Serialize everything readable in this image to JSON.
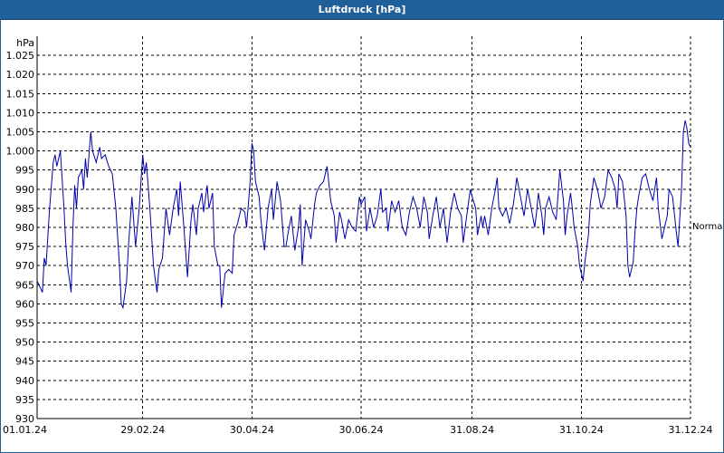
{
  "window": {
    "title": "Luftdruck [hPa]"
  },
  "colors": {
    "titlebar": "#1f5f9a",
    "line": "#0000aa",
    "grid": "#000000"
  },
  "chart_data": {
    "type": "line",
    "title": "Luftdruck [hPa]",
    "ylabel": "hPa",
    "ylim": [
      930,
      1030
    ],
    "yticks": [
      "930",
      "935",
      "940",
      "945",
      "950",
      "955",
      "960",
      "965",
      "970",
      "975",
      "980",
      "985",
      "990",
      "995",
      "1.000",
      "1.005",
      "1.010",
      "1.015",
      "1.020",
      "1.025"
    ],
    "ytick_values": [
      930,
      935,
      940,
      945,
      950,
      955,
      960,
      965,
      970,
      975,
      980,
      985,
      990,
      995,
      1000,
      1005,
      1010,
      1015,
      1020,
      1025
    ],
    "xlim": [
      "01.01.24",
      "31.12.24"
    ],
    "xticks": [
      "01.01.24",
      "29.02.24",
      "30.04.24",
      "30.06.24",
      "31.08.24",
      "31.10.24",
      "31.12.24"
    ],
    "xtick_days": [
      0,
      59,
      120,
      181,
      243,
      304,
      365
    ],
    "grid": true,
    "annotation": {
      "text": "Normal",
      "y": 980.5
    },
    "series_key": [
      [
        0,
        966
      ],
      [
        3,
        963
      ],
      [
        4,
        972
      ],
      [
        5,
        970
      ],
      [
        7,
        985
      ],
      [
        9,
        997
      ],
      [
        10,
        999
      ],
      [
        11,
        996
      ],
      [
        13,
        1000
      ],
      [
        15,
        985
      ],
      [
        16,
        976
      ],
      [
        17,
        970
      ],
      [
        19,
        963
      ],
      [
        20,
        980
      ],
      [
        21,
        991
      ],
      [
        22,
        985
      ],
      [
        23,
        993
      ],
      [
        25,
        995
      ],
      [
        26,
        990
      ],
      [
        27,
        998
      ],
      [
        28,
        993
      ],
      [
        30,
        1005
      ],
      [
        31,
        1000
      ],
      [
        33,
        997
      ],
      [
        35,
        1001
      ],
      [
        36,
        998
      ],
      [
        38,
        999
      ],
      [
        40,
        996
      ],
      [
        42,
        994
      ],
      [
        44,
        985
      ],
      [
        46,
        970
      ],
      [
        47,
        960
      ],
      [
        48,
        959
      ],
      [
        50,
        966
      ],
      [
        51,
        975
      ],
      [
        53,
        988
      ],
      [
        55,
        975
      ],
      [
        57,
        985
      ],
      [
        59,
        999
      ],
      [
        60,
        994
      ],
      [
        61,
        997
      ],
      [
        63,
        985
      ],
      [
        65,
        970
      ],
      [
        67,
        963
      ],
      [
        68,
        969
      ],
      [
        70,
        972
      ],
      [
        72,
        985
      ],
      [
        74,
        978
      ],
      [
        76,
        985
      ],
      [
        78,
        990
      ],
      [
        79,
        983
      ],
      [
        80,
        992
      ],
      [
        82,
        980
      ],
      [
        84,
        967
      ],
      [
        86,
        982
      ],
      [
        87,
        986
      ],
      [
        89,
        978
      ],
      [
        90,
        985
      ],
      [
        92,
        989
      ],
      [
        93,
        984
      ],
      [
        95,
        991
      ],
      [
        96,
        985
      ],
      [
        98,
        989
      ],
      [
        99,
        975
      ],
      [
        101,
        970
      ],
      [
        102,
        970
      ],
      [
        103,
        959
      ],
      [
        105,
        968
      ],
      [
        107,
        969
      ],
      [
        109,
        968
      ],
      [
        110,
        978
      ],
      [
        112,
        981
      ],
      [
        114,
        985
      ],
      [
        116,
        984
      ],
      [
        117,
        980
      ],
      [
        119,
        992
      ],
      [
        120,
        1002
      ],
      [
        121,
        1000
      ],
      [
        122,
        992
      ],
      [
        124,
        988
      ],
      [
        125,
        982
      ],
      [
        126,
        978
      ],
      [
        127,
        974
      ],
      [
        129,
        985
      ],
      [
        131,
        990
      ],
      [
        132,
        982
      ],
      [
        134,
        992
      ],
      [
        136,
        987
      ],
      [
        138,
        975
      ],
      [
        139,
        975
      ],
      [
        140,
        978
      ],
      [
        142,
        983
      ],
      [
        144,
        974
      ],
      [
        146,
        980
      ],
      [
        147,
        986
      ],
      [
        148,
        970
      ],
      [
        150,
        982
      ],
      [
        152,
        979
      ],
      [
        153,
        977
      ],
      [
        155,
        986
      ],
      [
        156,
        989
      ],
      [
        158,
        991
      ],
      [
        160,
        992
      ],
      [
        162,
        996
      ],
      [
        164,
        987
      ],
      [
        166,
        983
      ],
      [
        167,
        976
      ],
      [
        169,
        984
      ],
      [
        170,
        982
      ],
      [
        172,
        977
      ],
      [
        174,
        982
      ],
      [
        176,
        980
      ],
      [
        178,
        979
      ],
      [
        180,
        988
      ],
      [
        181,
        986
      ],
      [
        183,
        988
      ],
      [
        184,
        979
      ],
      [
        186,
        985
      ],
      [
        188,
        980
      ],
      [
        190,
        983
      ],
      [
        192,
        990
      ],
      [
        193,
        984
      ],
      [
        195,
        985
      ],
      [
        196,
        979
      ],
      [
        198,
        987
      ],
      [
        200,
        984
      ],
      [
        202,
        987
      ],
      [
        204,
        980
      ],
      [
        206,
        978
      ],
      [
        208,
        984
      ],
      [
        210,
        988
      ],
      [
        212,
        985
      ],
      [
        214,
        980
      ],
      [
        216,
        988
      ],
      [
        218,
        984
      ],
      [
        219,
        977
      ],
      [
        221,
        983
      ],
      [
        223,
        988
      ],
      [
        225,
        980
      ],
      [
        227,
        985
      ],
      [
        229,
        976
      ],
      [
        231,
        984
      ],
      [
        233,
        989
      ],
      [
        235,
        985
      ],
      [
        237,
        983
      ],
      [
        238,
        976
      ],
      [
        240,
        983
      ],
      [
        242,
        990
      ],
      [
        243,
        988
      ],
      [
        245,
        985
      ],
      [
        246,
        978
      ],
      [
        248,
        983
      ],
      [
        249,
        980
      ],
      [
        250,
        983
      ],
      [
        252,
        978
      ],
      [
        254,
        985
      ],
      [
        256,
        990
      ],
      [
        257,
        993
      ],
      [
        258,
        985
      ],
      [
        260,
        983
      ],
      [
        262,
        985
      ],
      [
        264,
        981
      ],
      [
        266,
        986
      ],
      [
        268,
        993
      ],
      [
        270,
        988
      ],
      [
        272,
        983
      ],
      [
        274,
        990
      ],
      [
        276,
        985
      ],
      [
        278,
        980
      ],
      [
        279,
        984
      ],
      [
        280,
        989
      ],
      [
        282,
        983
      ],
      [
        283,
        978
      ],
      [
        284,
        985
      ],
      [
        286,
        988
      ],
      [
        288,
        984
      ],
      [
        290,
        982
      ],
      [
        292,
        995
      ],
      [
        294,
        987
      ],
      [
        295,
        978
      ],
      [
        296,
        983
      ],
      [
        298,
        989
      ],
      [
        299,
        985
      ],
      [
        300,
        980
      ],
      [
        302,
        975
      ],
      [
        303,
        970
      ],
      [
        305,
        966
      ],
      [
        306,
        971
      ],
      [
        308,
        978
      ],
      [
        309,
        986
      ],
      [
        311,
        993
      ],
      [
        313,
        990
      ],
      [
        315,
        985
      ],
      [
        317,
        988
      ],
      [
        319,
        995
      ],
      [
        321,
        993
      ],
      [
        323,
        990
      ],
      [
        324,
        985
      ],
      [
        325,
        994
      ],
      [
        327,
        992
      ],
      [
        329,
        983
      ],
      [
        330,
        970
      ],
      [
        331,
        967
      ],
      [
        333,
        971
      ],
      [
        334,
        979
      ],
      [
        335,
        985
      ],
      [
        336,
        988
      ],
      [
        338,
        993
      ],
      [
        340,
        994
      ],
      [
        342,
        990
      ],
      [
        344,
        987
      ],
      [
        346,
        993
      ],
      [
        347,
        985
      ],
      [
        349,
        977
      ],
      [
        350,
        979
      ],
      [
        352,
        983
      ],
      [
        353,
        990
      ],
      [
        355,
        988
      ],
      [
        357,
        979
      ],
      [
        358,
        975
      ],
      [
        360,
        990
      ],
      [
        361,
        1005
      ],
      [
        362,
        1008
      ],
      [
        363,
        1006
      ],
      [
        364,
        1002
      ],
      [
        365,
        1001
      ]
    ]
  }
}
